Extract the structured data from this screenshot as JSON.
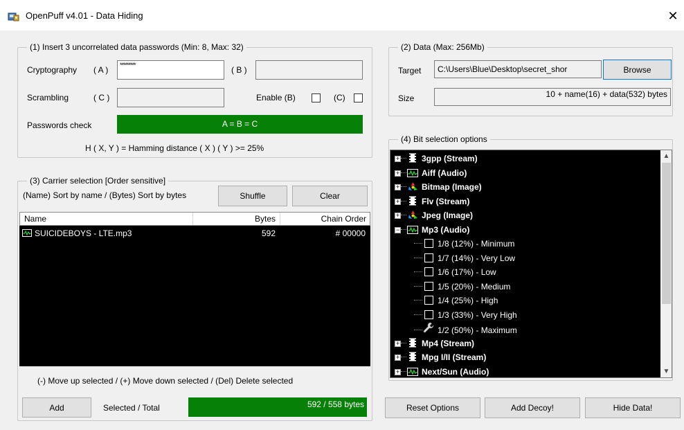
{
  "window": {
    "title": "OpenPuff v4.01 - Data Hiding",
    "close_glyph": "✕"
  },
  "passwords": {
    "legend": "(1) Insert 3 uncorrelated data passwords (Min: 8, Max: 32)",
    "crypto_label": "Cryptography",
    "a_label": "( A )",
    "a_value": "*********",
    "b_label": "( B )",
    "scrambling_label": "Scrambling",
    "c_label": "( C )",
    "enable_b_label": "Enable (B)",
    "enable_c_label": "(C)",
    "check_label": "Passwords check",
    "check_value": "A = B = C",
    "hamming_note": "H ( X, Y )  =  Hamming distance ( X ) ( Y )  >=  25%"
  },
  "carrier": {
    "legend": "(3)  Carrier selection [Order sensitive]",
    "sort_note": "(Name) Sort by name / (Bytes) Sort by bytes",
    "shuffle_label": "Shuffle",
    "clear_label": "Clear",
    "columns": [
      "Name",
      "Bytes",
      "Chain Order"
    ],
    "rows": [
      {
        "name": "SUICIDEBOYS - LTE.mp3",
        "bytes": "592",
        "chain": "# 00000",
        "icon": "audio-icon"
      }
    ],
    "help": "(-) Move up selected / (+) Move down selected / (Del) Delete selected",
    "add_label": "Add",
    "selected_label": "Selected / Total",
    "selected_value": "592 / 558 bytes"
  },
  "data": {
    "legend": "(2)  Data (Max: 256Mb)",
    "target_label": "Target",
    "target_value": "C:\\Users\\Blue\\Desktop\\secret_shor",
    "browse_label": "Browse",
    "size_label": "Size",
    "size_value": "10 + name(16) + data(532) bytes"
  },
  "bits": {
    "legend": "(4)  Bit selection options",
    "items": [
      {
        "label": "3gpp (Stream)",
        "icon": "film-icon",
        "expander": "+"
      },
      {
        "label": "Aiff (Audio)",
        "icon": "audio-icon",
        "expander": "+"
      },
      {
        "label": "Bitmap (Image)",
        "icon": "image-icon",
        "expander": "+"
      },
      {
        "label": "Flv (Stream)",
        "icon": "film-icon",
        "expander": "+"
      },
      {
        "label": "Jpeg (Image)",
        "icon": "image-icon",
        "expander": "+"
      },
      {
        "label": "Mp3 (Audio)",
        "icon": "audio-icon",
        "expander": "−"
      },
      {
        "label": "Mp4 (Stream)",
        "icon": "film-icon",
        "expander": "+"
      },
      {
        "label": "Mpg I/II (Stream)",
        "icon": "film-icon",
        "expander": "+"
      },
      {
        "label": "Next/Sun (Audio)",
        "icon": "audio-icon",
        "expander": "+"
      }
    ],
    "mp3_options": [
      {
        "label": "1/8 (12%) - Minimum",
        "icon": "checkbox-icon"
      },
      {
        "label": "1/7 (14%) - Very Low",
        "icon": "checkbox-icon"
      },
      {
        "label": "1/6 (17%) - Low",
        "icon": "checkbox-icon"
      },
      {
        "label": "1/5 (20%) - Medium",
        "icon": "checkbox-icon"
      },
      {
        "label": "1/4 (25%) - High",
        "icon": "checkbox-icon"
      },
      {
        "label": "1/3 (33%) - Very High",
        "icon": "checkbox-icon"
      },
      {
        "label": "1/2 (50%) - Maximum",
        "icon": "wrench-icon"
      }
    ]
  },
  "actions": {
    "reset_label": "Reset Options",
    "decoy_label": "Add Decoy!",
    "hide_label": "Hide Data!"
  },
  "colors": {
    "accent_green": "#078007",
    "focus_blue": "#0078d7"
  }
}
